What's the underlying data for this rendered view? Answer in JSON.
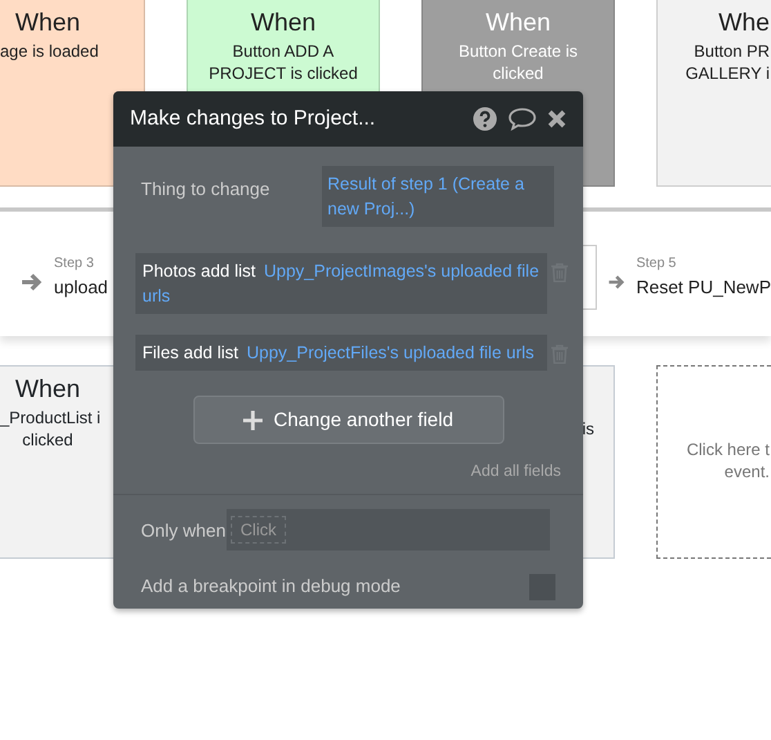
{
  "events": [
    {
      "title": "When",
      "lines": [
        "age is loaded"
      ],
      "color": "#ffdcc4"
    },
    {
      "title": "When",
      "lines": [
        "Button ADD A",
        "PROJECT is clicked"
      ],
      "color": "#ccfad2"
    },
    {
      "title": "When",
      "lines": [
        "Button Create is",
        "clicked"
      ],
      "color": "#9e9e9e"
    },
    {
      "title": "Whe",
      "lines": [
        "Button PR",
        "GALLERY i"
      ],
      "color": "#f2f2f2"
    }
  ],
  "steps": [
    {
      "kind": "step",
      "label": "Step 3",
      "text": "upload"
    },
    {
      "kind": "hidden"
    },
    {
      "kind": "step",
      "label": "Step 5",
      "text": "Reset PU_NewP"
    }
  ],
  "lower_events": [
    {
      "kind": "event",
      "title": "When",
      "lines": [
        "_ProductList i",
        "clicked"
      ]
    },
    {
      "kind": "event",
      "lines": [
        "is"
      ]
    },
    {
      "kind": "new",
      "lines": [
        "Click here t",
        "event."
      ]
    }
  ],
  "popup": {
    "title": "Make changes to Project...",
    "thing_label": "Thing to change",
    "thing_value": "Result of step 1 (Create a new Proj...)",
    "changes": [
      {
        "field": "Photos add list",
        "value": "Uppy_ProjectImages's uploaded file urls"
      },
      {
        "field": "Files add list",
        "value": "Uppy_ProjectFiles's uploaded file urls"
      }
    ],
    "add_button": "Change another field",
    "add_all": "Add all fields",
    "only_when_label": "Only when",
    "only_when_placeholder": "Click",
    "breakpoint_label": "Add a breakpoint in debug mode",
    "breakpoint_checked": false
  }
}
